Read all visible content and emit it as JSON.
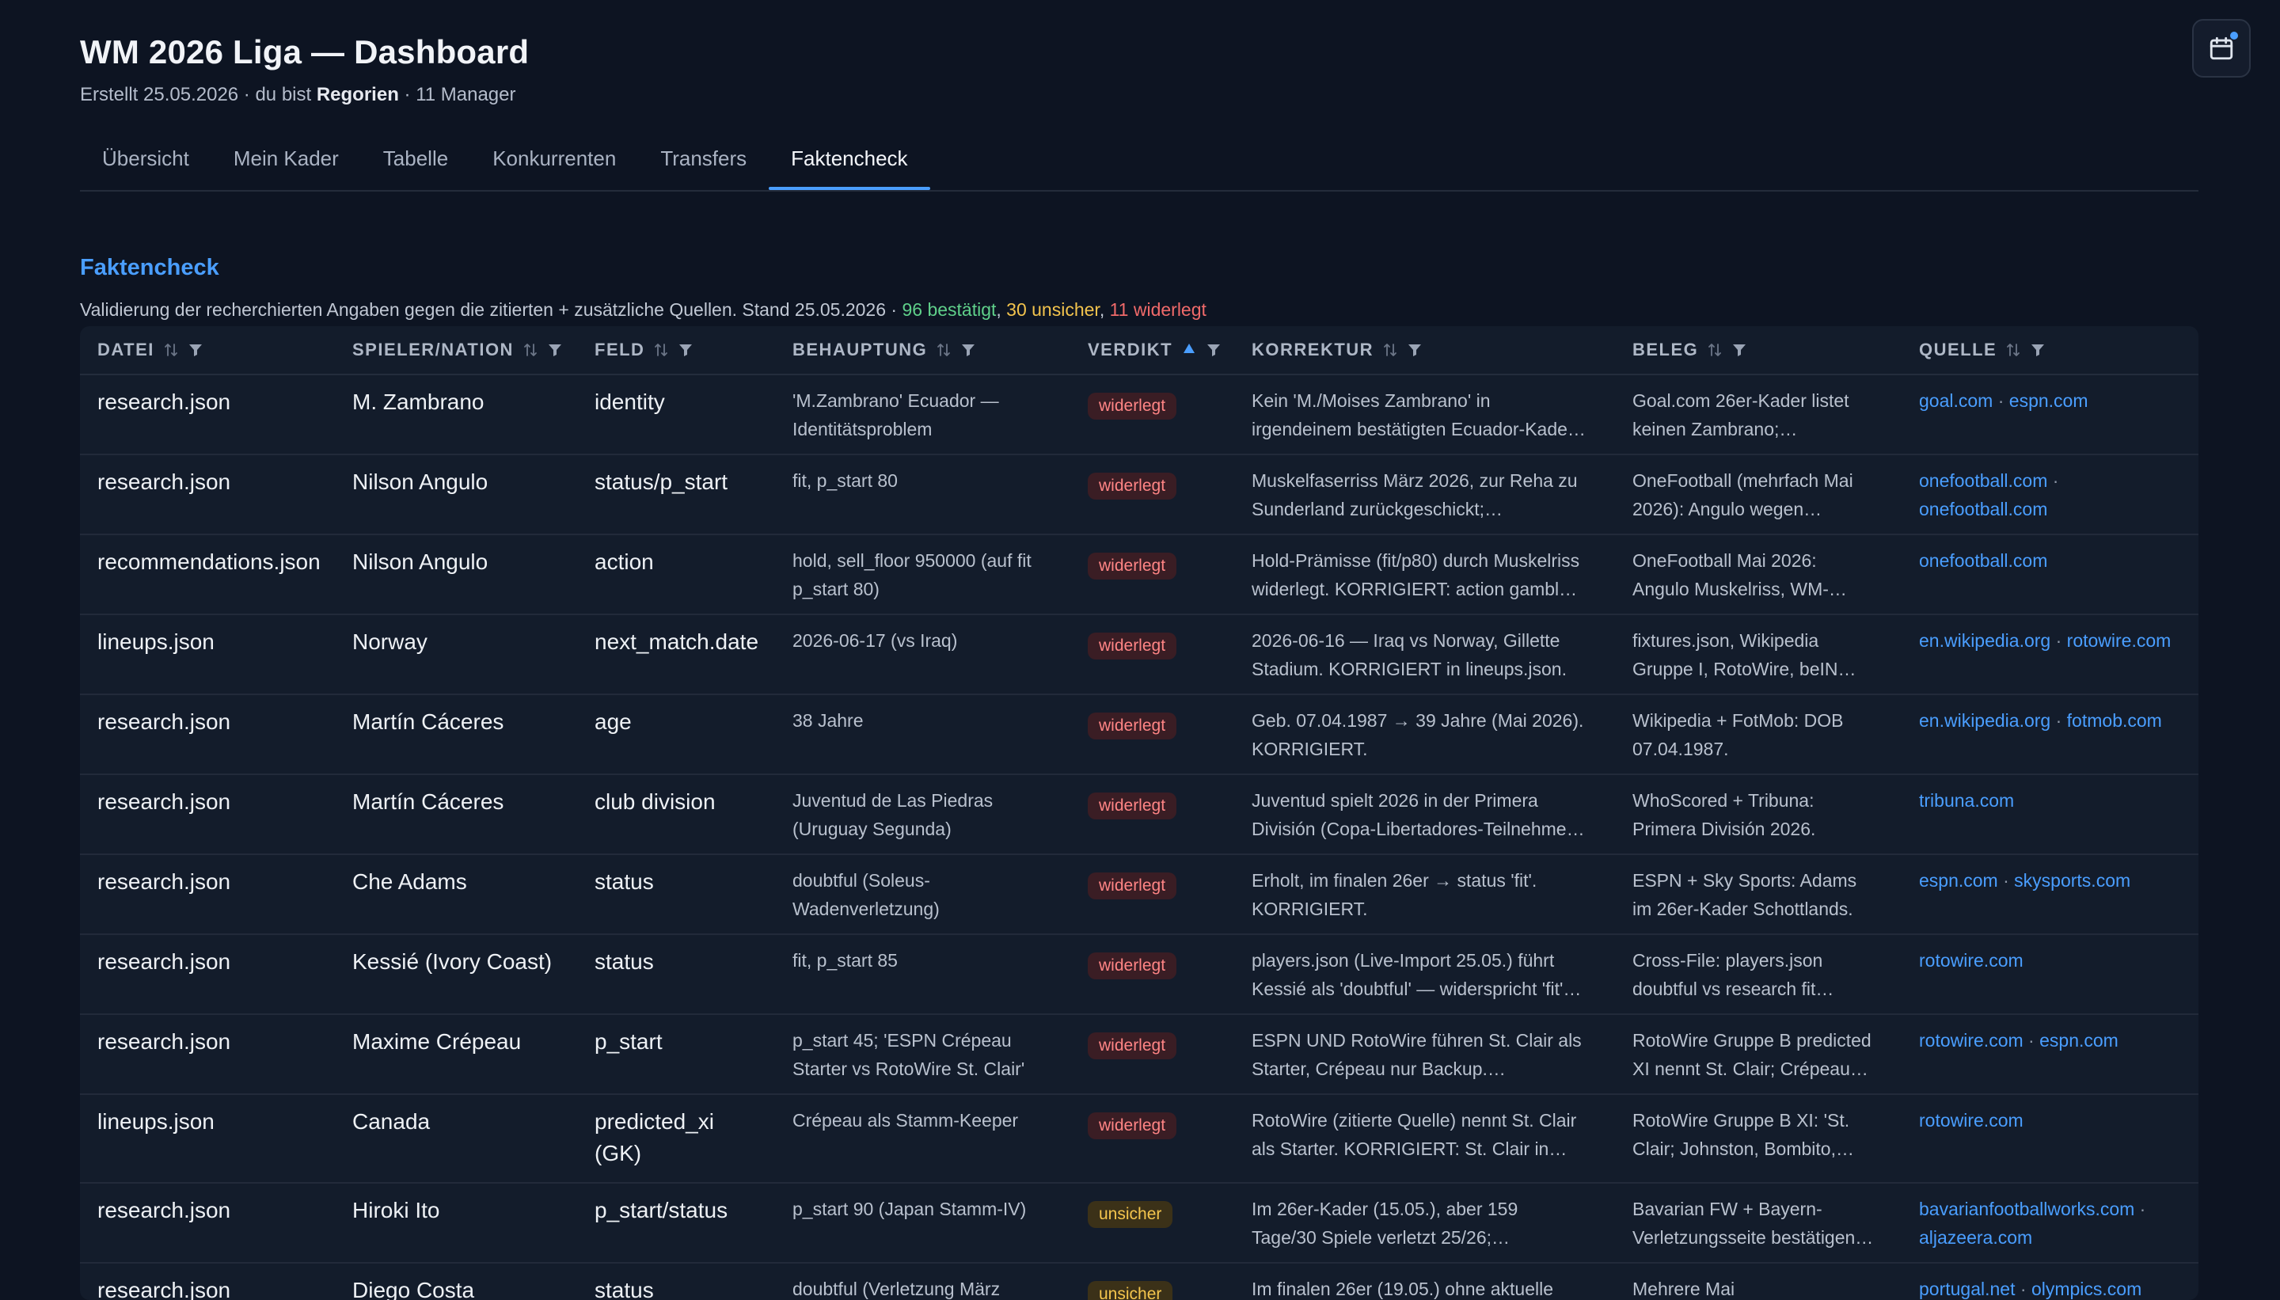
{
  "header": {
    "title": "WM 2026 Liga — Dashboard",
    "subtitle_prefix": "Erstellt 25.05.2026 · du bist ",
    "user": "Regorien",
    "subtitle_suffix": " · 11 Manager"
  },
  "tabs": [
    {
      "label": "Übersicht"
    },
    {
      "label": "Mein Kader"
    },
    {
      "label": "Tabelle"
    },
    {
      "label": "Konkurrenten"
    },
    {
      "label": "Transfers"
    },
    {
      "label": "Faktencheck",
      "active": true
    }
  ],
  "section": {
    "title": "Faktencheck",
    "desc": "Validierung der recherchierten Angaben gegen die zitierten + zusätzliche Quellen. Stand 25.05.2026 · ",
    "confirmed": "96 bestätigt",
    "sep1": ", ",
    "unsure": "30 unsicher",
    "sep2": ", ",
    "refuted": "11 widerlegt"
  },
  "columns": {
    "datei": "DATEI",
    "spieler": "SPIELER/NATION",
    "feld": "FELD",
    "behauptung": "BEHAUPTUNG",
    "verdikt": "VERDIKT",
    "korrektur": "KORREKTUR",
    "beleg": "BELEG",
    "quelle": "QUELLE"
  },
  "rows": [
    {
      "datei": "research.json",
      "spieler": "M. Zambrano",
      "feld": [
        "identity"
      ],
      "beh": [
        "'M.Zambrano' Ecuador —",
        "Identitätsproblem"
      ],
      "verdikt": "widerlegt",
      "kor": [
        "Kein 'M./Moises Zambrano' in",
        "irgendeinem bestätigten Ecuador-Kade…"
      ],
      "beleg": [
        "Goal.com 26er-Kader listet",
        "keinen Zambrano;…"
      ],
      "quelle": [
        [
          "goal.com",
          "espn.com"
        ]
      ]
    },
    {
      "datei": "research.json",
      "spieler": "Nilson Angulo",
      "feld": [
        "status/p_start"
      ],
      "beh": [
        "fit, p_start 80"
      ],
      "verdikt": "widerlegt",
      "kor": [
        "Muskelfaserriss März 2026, zur Reha zu",
        "Sunderland zurückgeschickt;…"
      ],
      "beleg": [
        "OneFootball (mehrfach Mai",
        "2026): Angulo wegen…"
      ],
      "quelle": [
        [
          "onefootball.com"
        ],
        [
          "onefootball.com"
        ]
      ],
      "trail": true
    },
    {
      "datei": "recommendations.json",
      "spieler": "Nilson Angulo",
      "feld": [
        "action"
      ],
      "beh": [
        "hold, sell_floor 950000 (auf fit",
        "p_start 80)"
      ],
      "verdikt": "widerlegt",
      "kor": [
        "Hold-Prämisse (fit/p80) durch Muskelriss",
        "widerlegt. KORRIGIERT: action gambl…"
      ],
      "beleg": [
        "OneFootball Mai 2026:",
        "Angulo Muskelriss, WM-…"
      ],
      "quelle": [
        [
          "onefootball.com"
        ]
      ]
    },
    {
      "datei": "lineups.json",
      "spieler": "Norway",
      "feld": [
        "next_match.date"
      ],
      "beh": [
        "2026-06-17 (vs Iraq)"
      ],
      "verdikt": "widerlegt",
      "kor": [
        "2026-06-16 — Iraq vs Norway, Gillette",
        "Stadium. KORRIGIERT in lineups.json."
      ],
      "beleg": [
        "fixtures.json, Wikipedia",
        "Gruppe I, RotoWire, beIN…"
      ],
      "quelle": [
        [
          "en.wikipedia.org",
          "rotowire.com"
        ]
      ]
    },
    {
      "datei": "research.json",
      "spieler": "Martín Cáceres",
      "feld": [
        "age"
      ],
      "beh": [
        "38 Jahre"
      ],
      "verdikt": "widerlegt",
      "kor": [
        "Geb. 07.04.1987 → 39 Jahre (Mai 2026).",
        "KORRIGIERT."
      ],
      "beleg": [
        "Wikipedia + FotMob: DOB",
        "07.04.1987."
      ],
      "quelle": [
        [
          "en.wikipedia.org",
          "fotmob.com"
        ]
      ]
    },
    {
      "datei": "research.json",
      "spieler": "Martín Cáceres",
      "feld": [
        "club division"
      ],
      "beh": [
        "Juventud de Las Piedras",
        "(Uruguay Segunda)"
      ],
      "verdikt": "widerlegt",
      "kor": [
        "Juventud spielt 2026 in der Primera",
        "División (Copa-Libertadores-Teilnehme…"
      ],
      "beleg": [
        "WhoScored + Tribuna:",
        "Primera División 2026."
      ],
      "quelle": [
        [
          "tribuna.com"
        ]
      ]
    },
    {
      "datei": "research.json",
      "spieler": "Che Adams",
      "feld": [
        "status"
      ],
      "beh": [
        "doubtful (Soleus-",
        "Wadenverletzung)"
      ],
      "verdikt": "widerlegt",
      "kor": [
        "Erholt, im finalen 26er → status 'fit'.",
        "KORRIGIERT."
      ],
      "beleg": [
        "ESPN + Sky Sports: Adams",
        "im 26er-Kader Schottlands."
      ],
      "quelle": [
        [
          "espn.com",
          "skysports.com"
        ]
      ]
    },
    {
      "datei": "research.json",
      "spieler": "Kessié (Ivory Coast)",
      "feld": [
        "status"
      ],
      "beh": [
        "fit, p_start 85"
      ],
      "verdikt": "widerlegt",
      "kor": [
        "players.json (Live-Import 25.05.) führt",
        "Kessié als 'doubtful' — widerspricht 'fit'…"
      ],
      "beleg": [
        "Cross-File: players.json",
        "doubtful vs research fit…"
      ],
      "quelle": [
        [
          "rotowire.com"
        ]
      ]
    },
    {
      "datei": "research.json",
      "spieler": "Maxime Crépeau",
      "feld": [
        "p_start"
      ],
      "beh": [
        "p_start 45; 'ESPN Crépeau",
        "Starter vs RotoWire St. Clair'"
      ],
      "verdikt": "widerlegt",
      "kor": [
        "ESPN UND RotoWire führen St. Clair als",
        "Starter, Crépeau nur Backup.…"
      ],
      "beleg": [
        "RotoWire Gruppe B predicted",
        "XI nennt St. Clair; Crépeau…"
      ],
      "quelle": [
        [
          "rotowire.com",
          "espn.com"
        ]
      ]
    },
    {
      "datei": "lineups.json",
      "spieler": "Canada",
      "feld": [
        "predicted_xi",
        "(GK)"
      ],
      "beh": [
        "Crépeau als Stamm-Keeper"
      ],
      "verdikt": "widerlegt",
      "kor": [
        "RotoWire (zitierte Quelle) nennt St. Clair",
        "als Starter. KORRIGIERT: St. Clair in…"
      ],
      "beleg": [
        "RotoWire Gruppe B XI: 'St.",
        "Clair; Johnston, Bombito,…"
      ],
      "quelle": [
        [
          "rotowire.com"
        ]
      ],
      "tall": true
    },
    {
      "datei": "research.json",
      "spieler": "Hiroki Ito",
      "feld": [
        "p_start/status"
      ],
      "beh": [
        "p_start 90 (Japan Stamm-IV)"
      ],
      "verdikt": "unsicher",
      "kor": [
        "Im 26er-Kader (15.05.), aber 159",
        "Tage/30 Spiele verletzt 25/26;…"
      ],
      "beleg": [
        "Bavarian FW + Bayern-",
        "Verletzungsseite bestätigen…"
      ],
      "quelle": [
        [
          "bavarianfootballworks.com"
        ],
        [
          "aljazeera.com"
        ]
      ],
      "trail": true
    },
    {
      "datei": "research.json",
      "spieler": "Diego Costa",
      "feld": [
        "status"
      ],
      "beh": [
        "doubtful (Verletzung März"
      ],
      "verdikt": "unsicher",
      "kor": [
        "Im finalen 26er (19.05.) ohne aktuelle"
      ],
      "beleg": [
        "Mehrere Mai"
      ],
      "quelle": [
        [
          "portugal.net",
          "olympics.com"
        ]
      ]
    }
  ]
}
